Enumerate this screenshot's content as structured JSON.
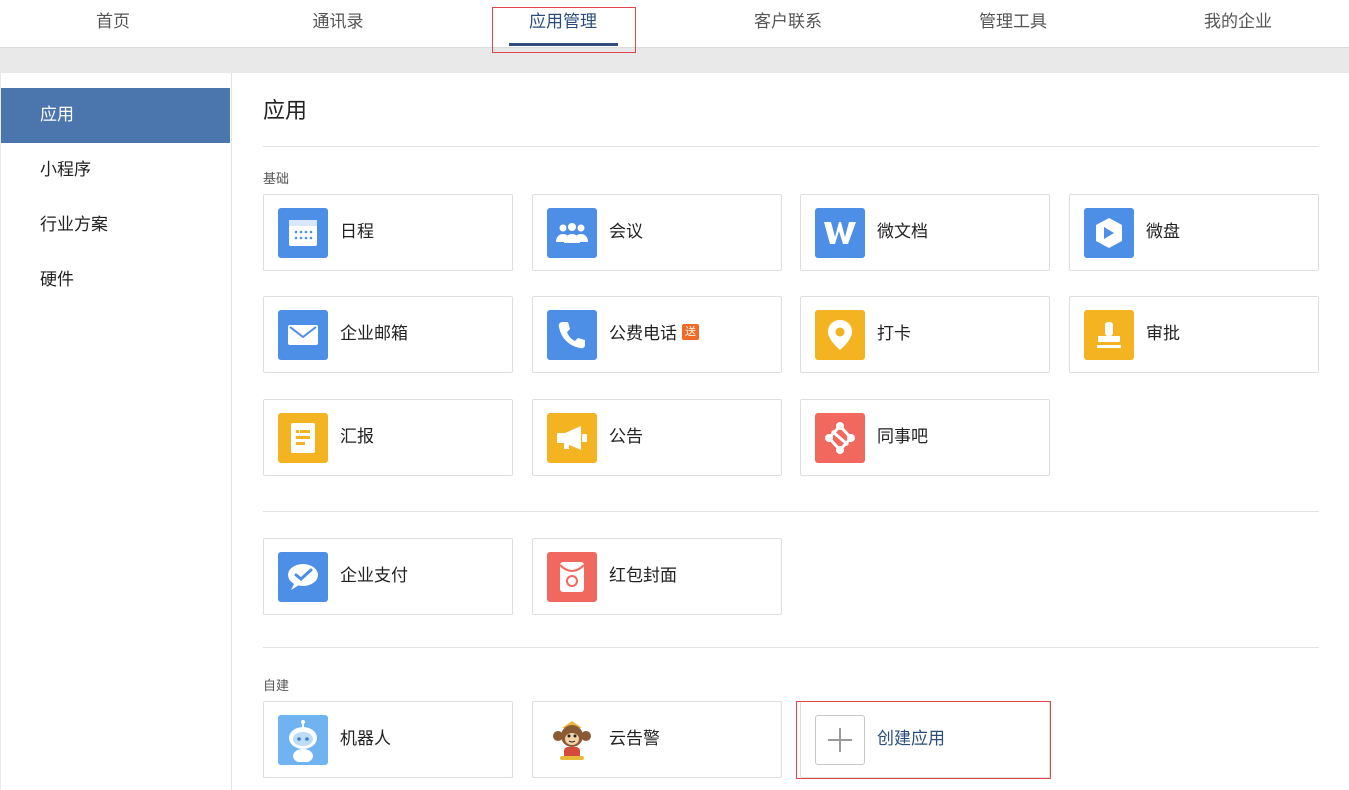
{
  "nav": {
    "items": [
      {
        "label": "首页"
      },
      {
        "label": "通讯录"
      },
      {
        "label": "应用管理"
      },
      {
        "label": "客户联系"
      },
      {
        "label": "管理工具"
      },
      {
        "label": "我的企业"
      }
    ],
    "active": "应用管理"
  },
  "sidebar": {
    "items": [
      {
        "label": "应用"
      },
      {
        "label": "小程序"
      },
      {
        "label": "行业方案"
      },
      {
        "label": "硬件"
      }
    ],
    "active": "应用"
  },
  "main": {
    "title": "应用",
    "sections": {
      "basic": {
        "label": "基础",
        "apps": [
          {
            "name": "日程",
            "icon": "calendar-icon"
          },
          {
            "name": "会议",
            "icon": "meeting-icon"
          },
          {
            "name": "微文档",
            "icon": "document-icon"
          },
          {
            "name": "微盘",
            "icon": "drive-icon"
          },
          {
            "name": "企业邮箱",
            "icon": "mail-icon"
          },
          {
            "name": "公费电话",
            "icon": "phone-icon",
            "badge": "送"
          },
          {
            "name": "打卡",
            "icon": "location-pin-icon"
          },
          {
            "name": "审批",
            "icon": "stamp-icon"
          },
          {
            "name": "汇报",
            "icon": "report-icon"
          },
          {
            "name": "公告",
            "icon": "megaphone-icon"
          },
          {
            "name": "同事吧",
            "icon": "network-icon"
          }
        ]
      },
      "payment": {
        "apps": [
          {
            "name": "企业支付",
            "icon": "payment-icon"
          },
          {
            "name": "红包封面",
            "icon": "red-envelope-icon"
          }
        ]
      },
      "custom": {
        "label": "自建",
        "apps": [
          {
            "name": "机器人",
            "icon": "robot-icon"
          },
          {
            "name": "云告警",
            "icon": "monkey-icon"
          }
        ],
        "create_label": "创建应用"
      }
    }
  },
  "colors": {
    "accent": "#4a76ad",
    "nav_active": "#2a4d7c",
    "blue_icon": "#4d8fe6",
    "yellow_icon": "#f4b321",
    "red_icon": "#f0685e",
    "badge": "#f06a25",
    "highlight": "#e0464b"
  }
}
